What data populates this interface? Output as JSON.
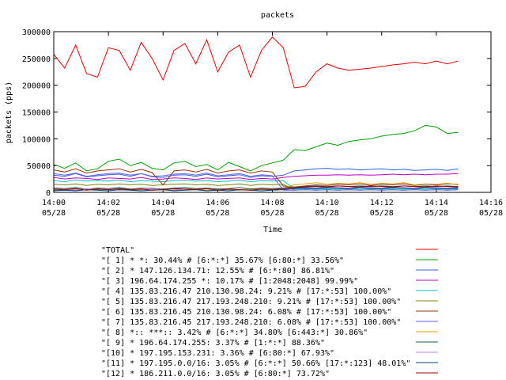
{
  "chart_data": {
    "type": "line",
    "title": "packets",
    "xlabel": "Time",
    "ylabel": "packets (pps)",
    "x_unit": "minutes since 14:00 on 05/28",
    "xlim": [
      0,
      16
    ],
    "ylim": [
      0,
      300000
    ],
    "yticks": [
      {
        "value": 0,
        "label": "0"
      },
      {
        "value": 50000,
        "label": "50000"
      },
      {
        "value": 100000,
        "label": "100000"
      },
      {
        "value": 150000,
        "label": "150000"
      },
      {
        "value": 200000,
        "label": "200000"
      },
      {
        "value": 250000,
        "label": "250000"
      },
      {
        "value": 300000,
        "label": "300000"
      }
    ],
    "xticks": [
      {
        "value": 0,
        "time": "14:00",
        "date": "05/28"
      },
      {
        "value": 2,
        "time": "14:02",
        "date": "05/28"
      },
      {
        "value": 4,
        "time": "14:04",
        "date": "05/28"
      },
      {
        "value": 6,
        "time": "14:06",
        "date": "05/28"
      },
      {
        "value": 8,
        "time": "14:08",
        "date": "05/28"
      },
      {
        "value": 10,
        "time": "14:10",
        "date": "05/28"
      },
      {
        "value": 12,
        "time": "14:12",
        "date": "05/28"
      },
      {
        "value": 14,
        "time": "14:14",
        "date": "05/28"
      },
      {
        "value": 16,
        "time": "14:16",
        "date": "05/28"
      }
    ],
    "x": [
      0,
      0.4,
      0.8,
      1.2,
      1.6,
      2.0,
      2.4,
      2.8,
      3.2,
      3.6,
      4.0,
      4.4,
      4.8,
      5.2,
      5.6,
      6.0,
      6.4,
      6.8,
      7.2,
      7.6,
      8.0,
      8.4,
      8.8,
      9.2,
      9.6,
      10.0,
      10.4,
      10.8,
      11.2,
      11.6,
      12.0,
      12.4,
      12.8,
      13.2,
      13.6,
      14.0,
      14.4,
      14.8
    ],
    "series": [
      {
        "name": "\"TOTAL\"",
        "color": "#e00000",
        "values": [
          258000,
          232000,
          275000,
          222000,
          215000,
          270000,
          265000,
          228000,
          280000,
          250000,
          210000,
          265000,
          278000,
          240000,
          285000,
          225000,
          262000,
          275000,
          215000,
          265000,
          290000,
          270000,
          195000,
          198000,
          225000,
          240000,
          232000,
          228000,
          230000,
          232000,
          235000,
          238000,
          240000,
          243000,
          240000,
          245000,
          240000,
          245000
        ]
      },
      {
        "name": "\"[ 1] * *: 30.44% # [6:*:*] 35.67% [6:80:*] 33.56%\"",
        "color": "#00a000",
        "values": [
          52000,
          45000,
          55000,
          40000,
          44000,
          58000,
          62000,
          50000,
          56000,
          45000,
          42000,
          55000,
          58000,
          48000,
          52000,
          42000,
          56000,
          48000,
          40000,
          50000,
          55000,
          60000,
          80000,
          78000,
          85000,
          92000,
          88000,
          95000,
          98000,
          100000,
          105000,
          108000,
          110000,
          115000,
          125000,
          122000,
          110000,
          112000
        ]
      },
      {
        "name": "\"[ 2] * 147.126.134.71: 12.55% # [6:*:80] 86.81%\"",
        "color": "#3060e0",
        "values": [
          32000,
          30000,
          35000,
          29000,
          31000,
          33000,
          34000,
          30000,
          35000,
          29000,
          28000,
          32000,
          33000,
          30000,
          34000,
          29000,
          31000,
          33000,
          28000,
          31000,
          30000,
          32000,
          40000,
          42000,
          44000,
          45000,
          43000,
          44000,
          42000,
          43000,
          44000,
          42000,
          43000,
          41000,
          42000,
          43000,
          41000,
          44000
        ]
      },
      {
        "name": "\"[ 3] 196.64.174.255 *: 10.17% # [1:2048:2048] 99.99%\"",
        "color": "#c000c0",
        "values": [
          28000,
          25000,
          27000,
          26000,
          24000,
          27000,
          26000,
          25000,
          28000,
          24000,
          25000,
          27000,
          26000,
          24000,
          27000,
          25000,
          26000,
          27000,
          24000,
          26000,
          25000,
          28000,
          30000,
          31000,
          32000,
          32000,
          33000,
          32000,
          33000,
          32000,
          33000,
          34000,
          33000,
          34000,
          33000,
          34000,
          34000,
          35000
        ]
      },
      {
        "name": "\"[ 4] 135.83.216.47 210.130.98.24: 9.21% # [17:*:53] 100.00%\"",
        "color": "#00c0c0",
        "values": [
          22000,
          20000,
          23000,
          21000,
          22000,
          21000,
          23000,
          20000,
          22000,
          21000,
          20000,
          22000,
          23000,
          21000,
          22000,
          20000,
          21000,
          23000,
          20000,
          22000,
          21000,
          22000,
          6000,
          7000,
          6000,
          7000,
          6000,
          7000,
          6000,
          7000,
          6000,
          7000,
          6000,
          7000,
          6000,
          7000,
          6000,
          7000
        ]
      },
      {
        "name": "\"[ 5] 135.83.216.47 217.193.248.210: 9.21% # [17:*:53] 100.00%\"",
        "color": "#808000",
        "values": [
          15000,
          14000,
          16000,
          13000,
          15000,
          14000,
          16000,
          14000,
          15000,
          13000,
          14000,
          15000,
          16000,
          14000,
          15000,
          13000,
          14000,
          16000,
          13000,
          15000,
          14000,
          15000,
          4000,
          5000,
          4000,
          5000,
          4000,
          5000,
          4000,
          5000,
          4000,
          5000,
          4000,
          5000,
          4000,
          5000,
          4000,
          5000
        ]
      },
      {
        "name": "\"[ 6] 135.83.216.45 210.130.98.24: 6.08% # [17:*:53] 100.00%\"",
        "color": "#a03000",
        "values": [
          42000,
          38000,
          44000,
          36000,
          40000,
          42000,
          44000,
          38000,
          43000,
          37000,
          14000,
          40000,
          42000,
          38000,
          43000,
          36000,
          40000,
          42000,
          36000,
          40000,
          38000,
          12000,
          10000,
          12000,
          14000,
          13000,
          15000,
          14000,
          16000,
          13000,
          15000,
          14000,
          16000,
          13000,
          15000,
          14000,
          16000,
          15000
        ]
      },
      {
        "name": "\"[ 7] 135.83.216.45 217.193.248.210: 6.08% # [17:*:53] 100.00%\"",
        "color": "#6060ff",
        "values": [
          35000,
          32000,
          36000,
          30000,
          33000,
          35000,
          36000,
          32000,
          35000,
          30000,
          31000,
          34000,
          35000,
          32000,
          36000,
          31000,
          33000,
          35000,
          30000,
          33000,
          31000,
          4000,
          4000,
          5000,
          4000,
          5000,
          4000,
          5000,
          4000,
          5000,
          4000,
          5000,
          4000,
          5000,
          4000,
          5000,
          4000,
          5000
        ]
      },
      {
        "name": "\"[ 8] *:: ***:: 3.42% # [6:*:*] 34.80% [6:443:*] 30.86%\"",
        "color": "#e0a000",
        "values": [
          4000,
          5000,
          6000,
          4000,
          7000,
          5000,
          6000,
          4000,
          5000,
          8000,
          4000,
          5000,
          6000,
          7000,
          4000,
          6000,
          5000,
          4000,
          7000,
          5000,
          6000,
          8000,
          14000,
          16000,
          18000,
          15000,
          17000,
          16000,
          18000,
          15000,
          17000,
          16000,
          18000,
          14000,
          16000,
          15000,
          17000,
          14000
        ]
      },
      {
        "name": "\"[ 9] * 196.64.174.255: 3.37% # [1:*:*] 88.36%\"",
        "color": "#006060",
        "values": [
          8000,
          7000,
          9000,
          6000,
          8000,
          7000,
          9000,
          6000,
          8000,
          7000,
          6000,
          8000,
          9000,
          7000,
          8000,
          6000,
          7000,
          9000,
          6000,
          8000,
          7000,
          8000,
          10000,
          11000,
          12000,
          11000,
          12000,
          11000,
          12000,
          11000,
          12000,
          11000,
          12000,
          11000,
          12000,
          11000,
          12000,
          11000
        ]
      },
      {
        "name": "\"[10] * 197.195.153.231: 3.36% # [6:80:*] 67.93%\"",
        "color": "#c080ff",
        "values": [
          5000,
          6000,
          4000,
          7000,
          5000,
          6000,
          4000,
          5000,
          7000,
          6000,
          5000,
          4000,
          6000,
          5000,
          7000,
          4000,
          6000,
          5000,
          4000,
          6000,
          5000,
          6000,
          8000,
          9000,
          8000,
          10000,
          9000,
          8000,
          10000,
          9000,
          8000,
          10000,
          9000,
          8000,
          10000,
          9000,
          8000,
          9000
        ]
      },
      {
        "name": "\"[11] * 197.195.0.0/16: 3.05% # [6:*:*] 50.66% [17:*:123] 48.01%\"",
        "color": "#004080",
        "values": [
          3000,
          4000,
          3000,
          5000,
          4000,
          3000,
          5000,
          4000,
          3000,
          4000,
          5000,
          3000,
          4000,
          5000,
          3000,
          4000,
          3000,
          5000,
          4000,
          3000,
          4000,
          5000,
          7000,
          8000,
          7000,
          9000,
          8000,
          7000,
          9000,
          8000,
          7000,
          9000,
          8000,
          7000,
          9000,
          8000,
          7000,
          8000
        ]
      },
      {
        "name": "\"[12] * 186.211.0.0/16: 3.05% # [6:80:*] 73.72%\"",
        "color": "#a00000",
        "values": [
          6000,
          5000,
          7000,
          4000,
          6000,
          5000,
          7000,
          5000,
          6000,
          4000,
          5000,
          7000,
          6000,
          5000,
          7000,
          4000,
          6000,
          5000,
          4000,
          6000,
          5000,
          7000,
          9000,
          10000,
          11000,
          10000,
          12000,
          11000,
          10000,
          12000,
          11000,
          10000,
          12000,
          11000,
          10000,
          12000,
          11000,
          10000
        ]
      }
    ]
  }
}
